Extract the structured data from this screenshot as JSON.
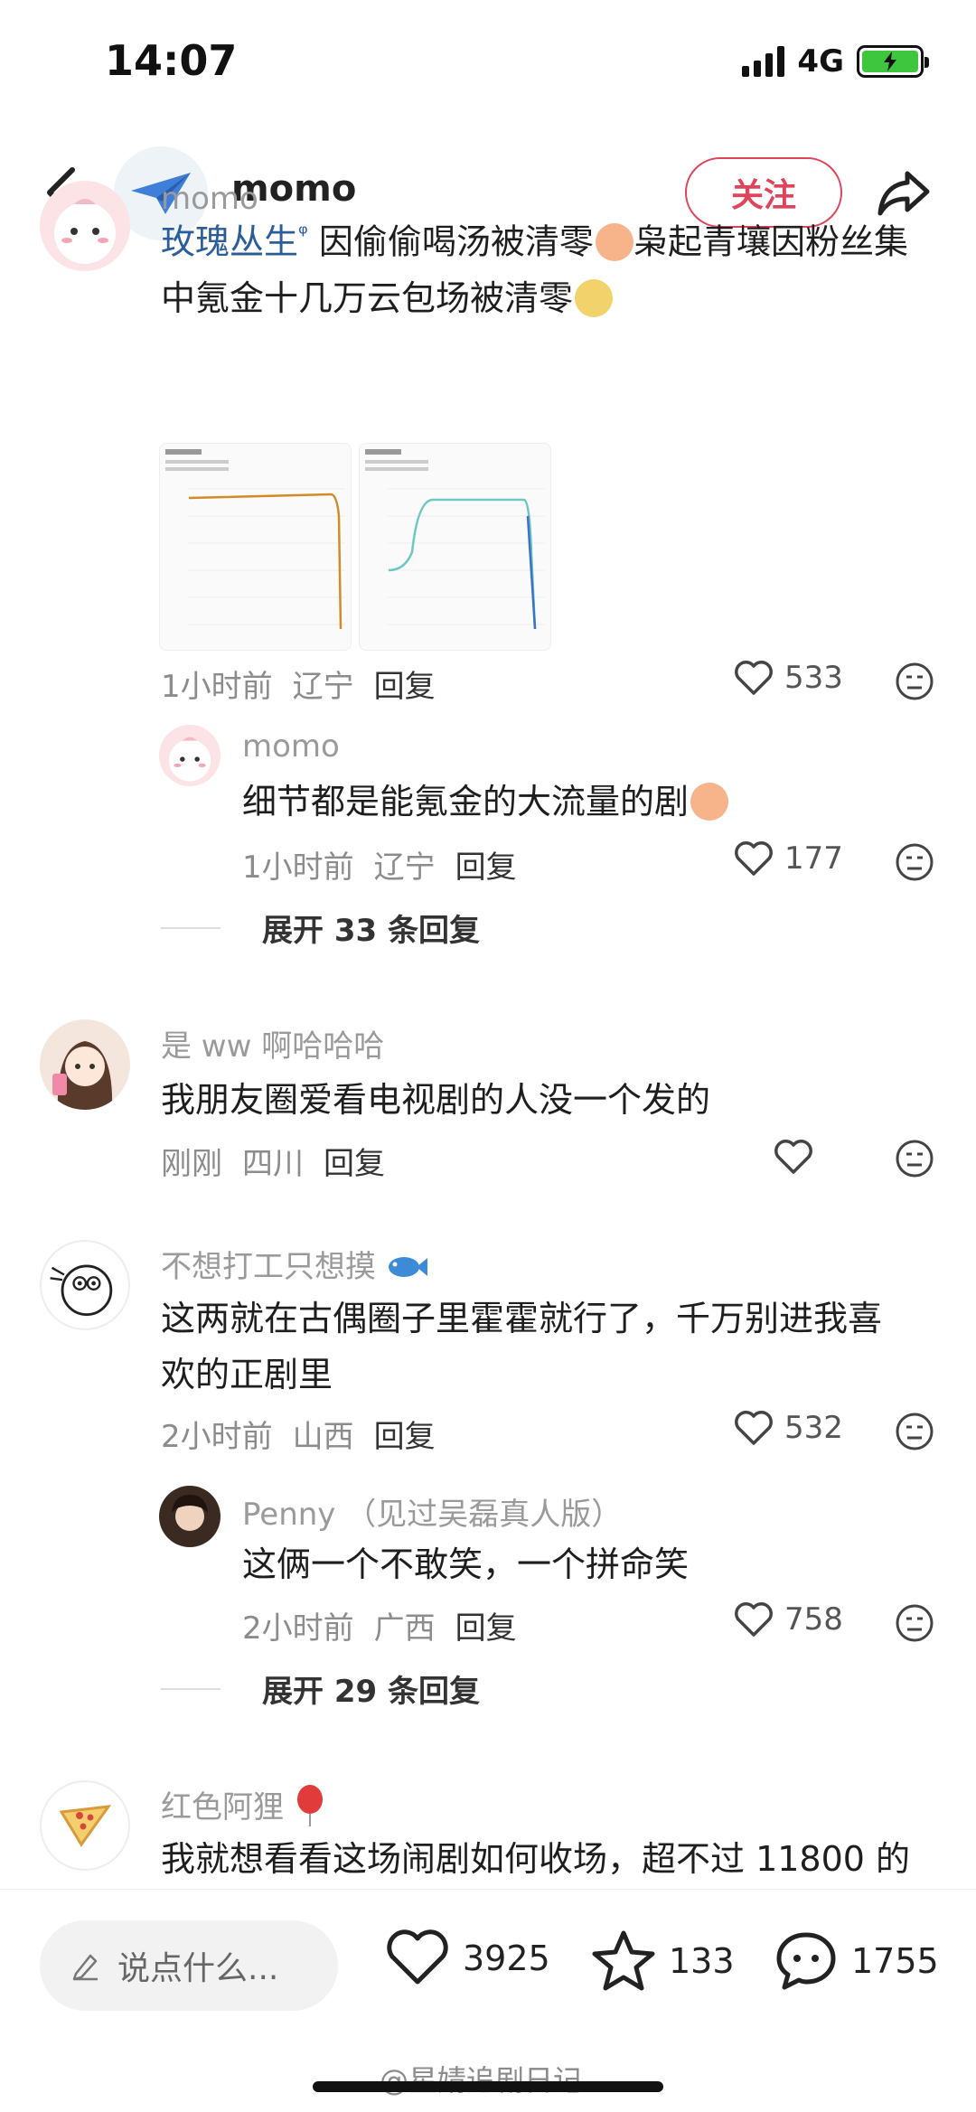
{
  "status": {
    "time": "14:07",
    "network": "4G"
  },
  "header": {
    "name": "momo",
    "follow_label": "关注"
  },
  "comments": [
    {
      "user": "momo",
      "topic": "玫瑰丛生",
      "text1": "因偷偷喝汤被清零",
      "text2": "枭起青壤因粉丝集中氪金十几万云包场被清零",
      "time": "1小时前",
      "location": "辽宁",
      "reply": "回复",
      "likes": "533",
      "replies": [
        {
          "user": "momo",
          "text": "细节都是能氪金的大流量的剧",
          "time": "1小时前",
          "location": "辽宁",
          "reply": "回复",
          "likes": "177"
        }
      ],
      "expand": "展开 33 条回复"
    },
    {
      "user": "是 ww 啊哈哈哈",
      "text": "我朋友圈爱看电视剧的人没一个发的",
      "time": "刚刚",
      "location": "四川",
      "reply": "回复"
    },
    {
      "user": "不想打工只想摸",
      "text_l1": "这两就在古偶圈子里霍霍就行了，千万别进我喜",
      "text_l2": "欢的正剧里",
      "time": "2小时前",
      "location": "山西",
      "reply": "回复",
      "likes": "532",
      "replies": [
        {
          "user": "Penny （见过吴磊真人版）",
          "text": "这俩一个不敢笑，一个拼命笑",
          "time": "2小时前",
          "location": "广西",
          "reply": "回复",
          "likes": "758"
        }
      ],
      "expand": "展开 29 条回复"
    },
    {
      "user": "红色阿狸",
      "text": "我就想看看这场闹剧如何收场，超不过 11800 的"
    }
  ],
  "bottom": {
    "input_placeholder": "说点什么...",
    "likes": "3925",
    "stars": "133",
    "comments": "1755"
  },
  "watermark": "@星婧追剧日记",
  "colors": {
    "accent": "#e0445a",
    "topic": "#2b5d9a",
    "battery": "#3ec73e"
  }
}
